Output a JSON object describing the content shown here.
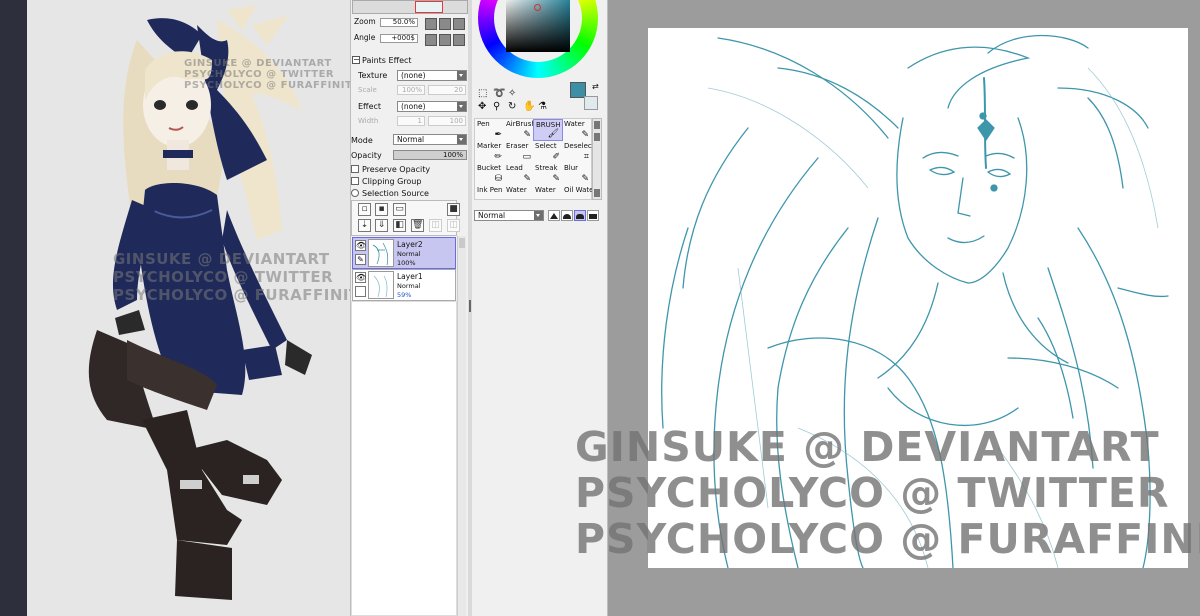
{
  "colors": {
    "panel_bg": "#f0f0f0",
    "selection": "#c7c6f0",
    "line_art": "#2a8ba3",
    "main_color": "#3d8fa6",
    "dark_frame": "#2e2f3c"
  },
  "left_canvas": {
    "watermark_top": [
      "GINSUKE @ DEVIANTART",
      "PSYCHOLYCO @ TWITTER",
      "PSYCHOLYCO @ FURAFFINITY"
    ],
    "watermark_mid": [
      "GINSUKE @ DEVIANTART",
      "PSYCHOLYCO @ TWITTER",
      "PSYCHOLYCO @ FURAFFINITY"
    ]
  },
  "navigator": {
    "zoom_label": "Zoom",
    "zoom_value": "50.0%",
    "angle_label": "Angle",
    "angle_value": "+000$"
  },
  "paints_effect": {
    "section_label": "Paints Effect",
    "texture_label": "Texture",
    "texture_value": "(none)",
    "scale_label": "Scale",
    "scale_value": "100%",
    "scale_num": "20",
    "effect_label": "Effect",
    "effect_value": "(none)",
    "width_label": "Width",
    "width_value": "1",
    "width_num": "100"
  },
  "layer_props": {
    "mode_label": "Mode",
    "mode_value": "Normal",
    "opacity_label": "Opacity",
    "opacity_value": "100%",
    "preserve_opacity": "Preserve Opacity",
    "clipping_group": "Clipping Group",
    "selection_source": "Selection Source"
  },
  "layers": [
    {
      "name": "Layer2",
      "mode": "Normal",
      "opacity": "100%"
    },
    {
      "name": "Layer1",
      "mode": "Normal",
      "opacity": "59%"
    }
  ],
  "tools": [
    {
      "label": "Pen",
      "icon": "pen-icon"
    },
    {
      "label": "AirBrush",
      "icon": "airbrush-icon"
    },
    {
      "label": "BRUSH",
      "icon": "brush-icon"
    },
    {
      "label": "Water",
      "icon": "water-icon"
    },
    {
      "label": "Marker",
      "icon": "marker-icon"
    },
    {
      "label": "Eraser",
      "icon": "eraser-icon"
    },
    {
      "label": "Select",
      "icon": "select-icon"
    },
    {
      "label": "Deselect",
      "icon": "deselect-icon"
    },
    {
      "label": "Bucket",
      "icon": "bucket-icon"
    },
    {
      "label": "Lead",
      "icon": "lead-icon"
    },
    {
      "label": "Streak",
      "icon": "streak-icon"
    },
    {
      "label": "Blur",
      "icon": "blur-icon"
    },
    {
      "label": "Ink Pen",
      "icon": "ink-pen-icon"
    },
    {
      "label": "Water",
      "icon": "water-icon"
    },
    {
      "label": "Water",
      "icon": "water-icon"
    },
    {
      "label": "Oil Wate",
      "icon": "oil-water-icon"
    }
  ],
  "brush_mode": {
    "value": "Normal"
  },
  "right_canvas": {
    "watermark": [
      "GINSUKE @ DEVIANTART",
      "PSYCHOLYCO @ TWITTER",
      "PSYCHOLYCO @ FURAFFINITY"
    ]
  }
}
